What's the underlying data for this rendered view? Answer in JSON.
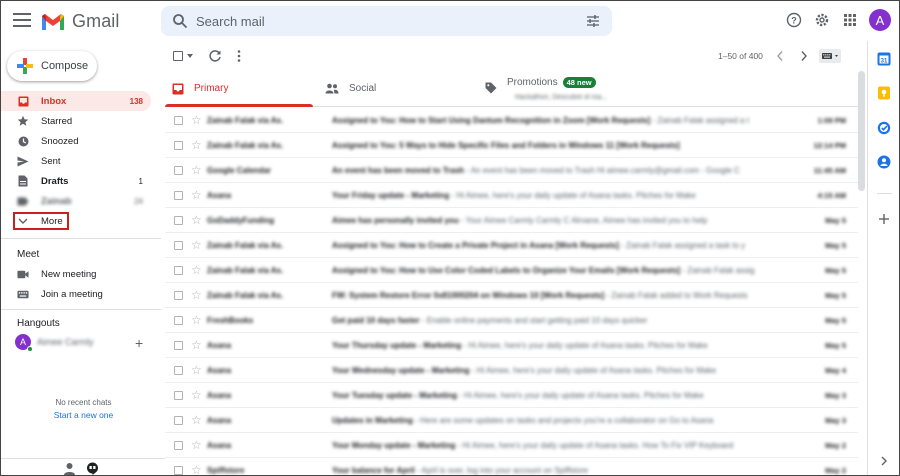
{
  "header": {
    "app_name": "Gmail",
    "search_placeholder": "Search mail",
    "avatar_letter": "A"
  },
  "sidebar": {
    "compose_label": "Compose",
    "items": [
      {
        "label": "Inbox",
        "count": "138",
        "icon": "inbox-icon"
      },
      {
        "label": "Starred",
        "count": "",
        "icon": "star-icon"
      },
      {
        "label": "Snoozed",
        "count": "",
        "icon": "clock-icon"
      },
      {
        "label": "Sent",
        "count": "",
        "icon": "send-icon"
      },
      {
        "label": "Drafts",
        "count": "1",
        "icon": "draft-icon"
      },
      {
        "label": "Zainab",
        "count": "24",
        "icon": "label-icon"
      },
      {
        "label": "More",
        "count": "",
        "icon": "chevron-down-icon"
      }
    ],
    "meet": {
      "title": "Meet",
      "new_meeting": "New meeting",
      "join_meeting": "Join a meeting"
    },
    "hangouts": {
      "title": "Hangouts",
      "user_initial": "A",
      "user_name": "Aimee Carmly",
      "no_chats": "No recent chats",
      "start_new": "Start a new one"
    }
  },
  "toolbar": {
    "pager_text": "1–50 of 400"
  },
  "tabs": [
    {
      "label": "Primary",
      "icon": "inbox-icon",
      "badge": ""
    },
    {
      "label": "Social",
      "icon": "people-icon",
      "badge": ""
    },
    {
      "label": "Promotions",
      "icon": "tag-icon",
      "badge": "48 new",
      "sub": "Hackathon, Descubre el ma..."
    }
  ],
  "emails": [
    {
      "sender": "Zainab Falak via As.",
      "subject": "Assigned to You: How to Start Using Dantum Recognition in Zoom [Work Requests]",
      "snippet": " - Zainab Falak assigned a t",
      "date": "1:09 PM"
    },
    {
      "sender": "Zainab Falak via As.",
      "subject": "Assigned to You: 5 Ways to Hide Specific Files and Folders in Windows 11 [Work Requests]",
      "snippet": "",
      "date": "12:14 PM"
    },
    {
      "sender": "Google Calendar",
      "subject": "An event has been moved to Trash",
      "snippet": " - An event has been moved to Trash Hi aimee.carmly@gmail.com - Google C",
      "date": "11:45 AM"
    },
    {
      "sender": "Asana",
      "subject": "Your Friday update - Marketing",
      "snippet": " - Hi Aimee, here's your daily update of Asana tasks. Pitches for Make",
      "date": "4:15 AM"
    },
    {
      "sender": "GoDaddyFunding",
      "subject": "Aimee has personally invited you",
      "snippet": " - Your Aimee Carmly Carmly C Alroane, Aimee has invited you to help",
      "date": "May 5"
    },
    {
      "sender": "Zainab Falak via As.",
      "subject": "Assigned to You: How to Create a Private Project in Asana [Work Requests]",
      "snippet": " - Zainab Falak assigned a task to y",
      "date": "May 5"
    },
    {
      "sender": "Zainab Falak via As.",
      "subject": "Assigned to You: How to Use Color Coded Labels to Organize Your Emails [Work Requests]",
      "snippet": " - Zainab Falak assig",
      "date": "May 5"
    },
    {
      "sender": "Zainab Falak via As.",
      "subject": "FW: System Restore Error 0x81000204 on Windows 10 [Work Requests]",
      "snippet": " - Zainab Falak added to Work Requests",
      "date": "May 5"
    },
    {
      "sender": "FreshBooks",
      "subject": "Get paid 10 days faster",
      "snippet": " - Enable online payments and start getting paid 10 days quicker",
      "date": "May 5"
    },
    {
      "sender": "Asana",
      "subject": "Your Thursday update - Marketing",
      "snippet": " - Hi Aimee, here's your daily update of Asana tasks. Pitches for Make",
      "date": "May 5"
    },
    {
      "sender": "Asana",
      "subject": "Your Wednesday update - Marketing",
      "snippet": " - Hi Aimee, here's your daily update of Asana tasks. Pitches for Make",
      "date": "May 4"
    },
    {
      "sender": "Asana",
      "subject": "Your Tuesday update - Marketing",
      "snippet": " - Hi Aimee, here's your daily update of Asana tasks. Pitches for Make",
      "date": "May 3"
    },
    {
      "sender": "Asana",
      "subject": "Updates in Marketing",
      "snippet": " - Here are some updates on tasks and projects you're a collaborator on Go to Asana",
      "date": "May 3"
    },
    {
      "sender": "Asana",
      "subject": "Your Monday update - Marketing",
      "snippet": " - Hi Aimee, here's your daily update of Asana tasks. How To Fix VIP Keyboard",
      "date": "May 2"
    },
    {
      "sender": "Spiffstore",
      "subject": "Your balance for April",
      "snippet": " - April is over, log into your account on Spiffstore",
      "date": "May 2"
    }
  ],
  "colors": {
    "accent_red": "#d93025",
    "active_bg": "#fce8e6",
    "badge_green": "#188038",
    "avatar_purple": "#8430ce",
    "search_bg": "#eaf1fb"
  }
}
